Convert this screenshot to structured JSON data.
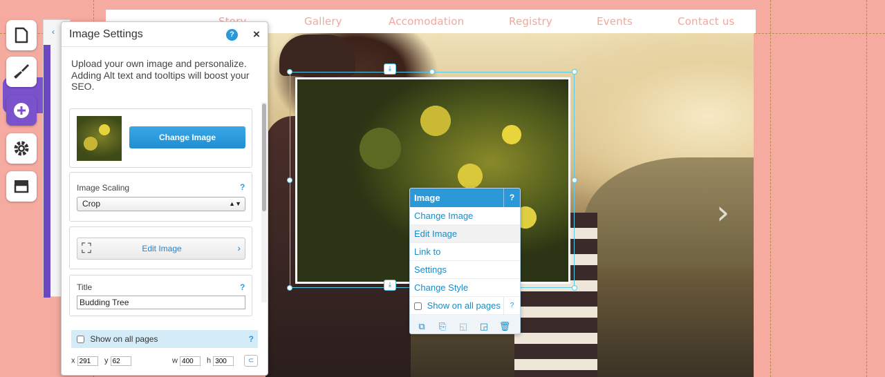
{
  "site_nav": {
    "items": [
      "Story",
      "Gallery",
      "Accomodation",
      "Registry",
      "Events",
      "Contact us"
    ]
  },
  "image_panel": {
    "title": "Image Settings",
    "help": "?",
    "close": "×",
    "description": "Upload your own image and personalize. Adding Alt text and tooltips will boost your SEO.",
    "change_image_label": "Change Image",
    "scaling_label": "Image Scaling",
    "scaling_help": "?",
    "scaling_value": "Crop",
    "edit_image_label": "Edit Image",
    "title_label": "Title",
    "title_help": "?",
    "title_value": "Budding Tree",
    "show_all_label": "Show on all pages",
    "show_all_help": "?",
    "coords": {
      "x_label": "x",
      "x_value": "291",
      "y_label": "y",
      "y_value": "62",
      "w_label": "w",
      "w_value": "400",
      "h_label": "h",
      "h_value": "300"
    }
  },
  "context_menu": {
    "title": "Image",
    "help": "?",
    "items": [
      "Change Image",
      "Edit Image",
      "Link to",
      "Settings",
      "Change Style"
    ],
    "show_all_label": "Show on all pages",
    "show_all_help": "?"
  },
  "colors": {
    "background": "#f5aba0",
    "accent_blue": "#2b99d8",
    "toolbar_active": "#7a52cc",
    "nav_link": "#f2a79c"
  },
  "icons": {
    "toolbar": [
      "pages-icon",
      "design-icon",
      "add-icon",
      "settings-icon",
      "store-icon"
    ],
    "context_tools": [
      "copy-icon",
      "paste-icon",
      "bring-forward-icon",
      "send-backward-icon",
      "trash-icon"
    ]
  }
}
